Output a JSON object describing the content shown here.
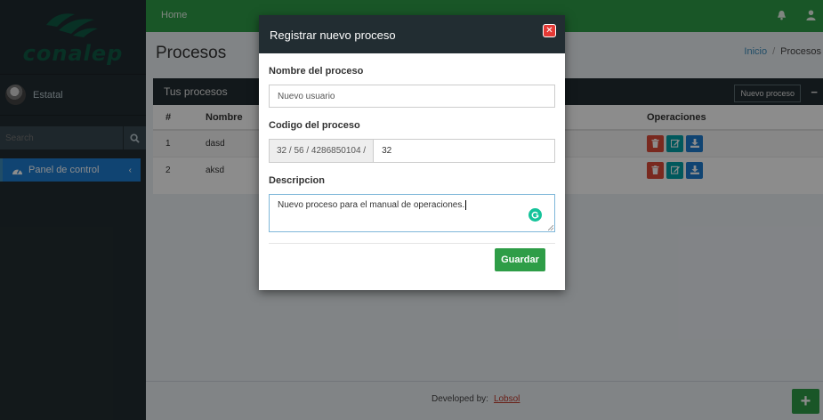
{
  "sidebar": {
    "logo_text": "conalep",
    "user_name": "Estatal",
    "search_placeholder": "Search",
    "menu_item_label": "Panel de control"
  },
  "topbar": {
    "home_label": "Home"
  },
  "page": {
    "title": "Procesos",
    "breadcrumb_home": "Inicio",
    "breadcrumb_sep": "/",
    "breadcrumb_current": "Procesos"
  },
  "box": {
    "title": "Tus procesos",
    "new_button": "Nuevo proceso",
    "minus": "−",
    "headers": [
      "#",
      "Nombre",
      "Operaciones"
    ],
    "rows": [
      {
        "num": "1",
        "name": "dasd"
      },
      {
        "num": "2",
        "name": "aksd"
      }
    ]
  },
  "footer": {
    "developed_by": "Developed by:",
    "brand": "Lobsol",
    "fab_label": "+"
  },
  "modal": {
    "title": "Registrar nuevo proceso",
    "close_label": "✕",
    "name_label": "Nombre del proceso",
    "name_placeholder": "Nuevo usuario",
    "code_label": "Codigo del proceso",
    "code_prefix": "32 / 56 / 4286850104 /",
    "code_value": "32",
    "desc_label": "Descripcion",
    "desc_value": "Nuevo proceso para el manual de operaciones.",
    "save_label": "Guardar"
  },
  "colors": {
    "green": "#2e9d47",
    "dark": "#222d32",
    "blue": "#1e7ccf",
    "red": "#dd4b39",
    "teal": "#00a0a8"
  }
}
